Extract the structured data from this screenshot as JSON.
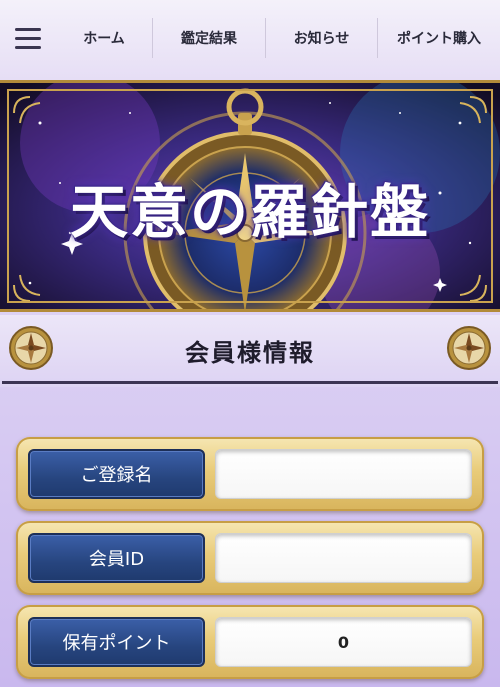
{
  "nav": {
    "menu_icon": "hamburger-menu-icon",
    "items": [
      {
        "label": "ホーム"
      },
      {
        "label": "鑑定結果"
      },
      {
        "label": "お知らせ"
      },
      {
        "label": "ポイント購入"
      }
    ]
  },
  "banner": {
    "title": "天意の羅針盤"
  },
  "section": {
    "title": "会員様情報",
    "icon": "compass-icon"
  },
  "fields": [
    {
      "label": "ご登録名",
      "value": ""
    },
    {
      "label": "会員ID",
      "value": ""
    },
    {
      "label": "保有ポイント",
      "value": "0"
    }
  ],
  "colors": {
    "accent_gold": "#d8b45c",
    "label_navy": "#27457f",
    "background_lavender": "#ddd2f4"
  }
}
